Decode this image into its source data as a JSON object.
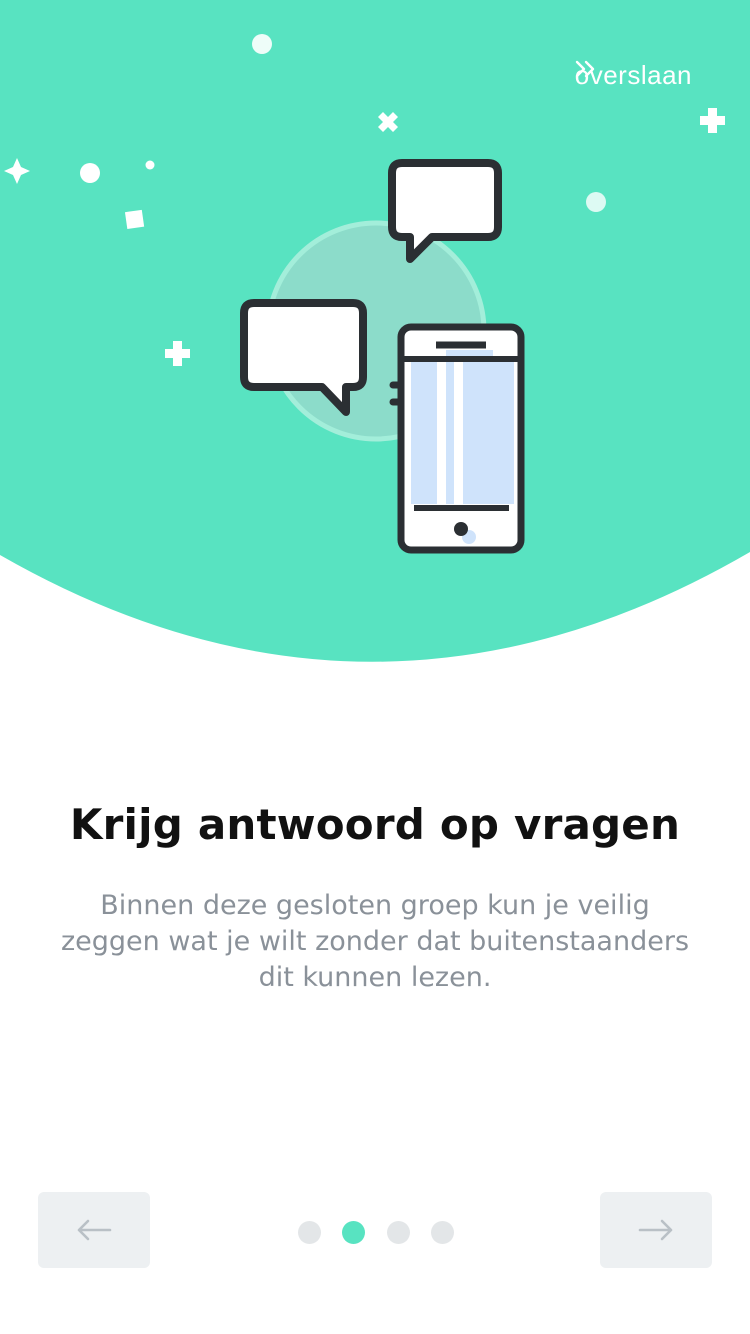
{
  "colors": {
    "accent": "#58e3c1",
    "title": "#111111",
    "body_text": "#8a9199",
    "button_bg": "#edf0f2",
    "dot_inactive": "#e3e6e8",
    "outline": "#2b2f33",
    "screen": "#cfe3fb"
  },
  "header": {
    "skip_label": "overslaan",
    "skip_icon": "double-chevron-right-icon"
  },
  "illustration": {
    "icons": [
      "chat-bubble-icon",
      "chat-bubble-icon",
      "smartphone-icon"
    ]
  },
  "content": {
    "title": "Krijg antwoord op vragen",
    "description": "Binnen deze gesloten groep kun je veilig zeggen wat je wilt zonder dat buitenstaanders dit kunnen lezen."
  },
  "pager": {
    "total": 4,
    "active_index": 1,
    "prev_icon": "arrow-left-icon",
    "next_icon": "arrow-right-icon"
  }
}
